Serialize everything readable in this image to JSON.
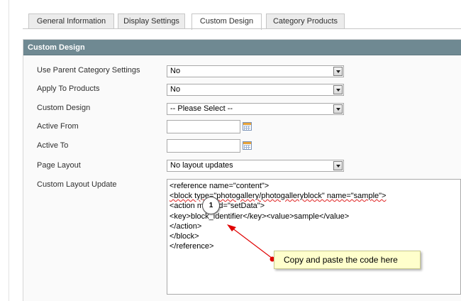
{
  "tabs": [
    {
      "label": "General Information",
      "active": false
    },
    {
      "label": "Display Settings",
      "active": false
    },
    {
      "label": "Custom Design",
      "active": true
    },
    {
      "label": "Category Products",
      "active": false
    }
  ],
  "panel": {
    "title": "Custom Design"
  },
  "fields": {
    "use_parent": {
      "label": "Use Parent Category Settings",
      "value": "No"
    },
    "apply_products": {
      "label": "Apply To Products",
      "value": "No"
    },
    "custom_design": {
      "label": "Custom Design",
      "value": "-- Please Select --"
    },
    "active_from": {
      "label": "Active From",
      "value": ""
    },
    "active_to": {
      "label": "Active To",
      "value": ""
    },
    "page_layout": {
      "label": "Page Layout",
      "value": "No layout updates"
    },
    "layout_update": {
      "label": "Custom Layout Update",
      "lines": [
        "<reference name=\"content\">",
        "<block type=\"photogallery/photogalleryblock\" name=\"sample\">",
        "<action method=\"setData\">",
        "<key>block_identifier</key><value>sample</value>",
        "</action>",
        "</block>",
        "</reference>"
      ]
    }
  },
  "annotation": {
    "badge": "1",
    "tooltip": "Copy and paste the code here",
    "arrow_color": "#e00000"
  },
  "colors": {
    "panel_header": "#6f8992",
    "tooltip_bg": "#ffffcc"
  }
}
